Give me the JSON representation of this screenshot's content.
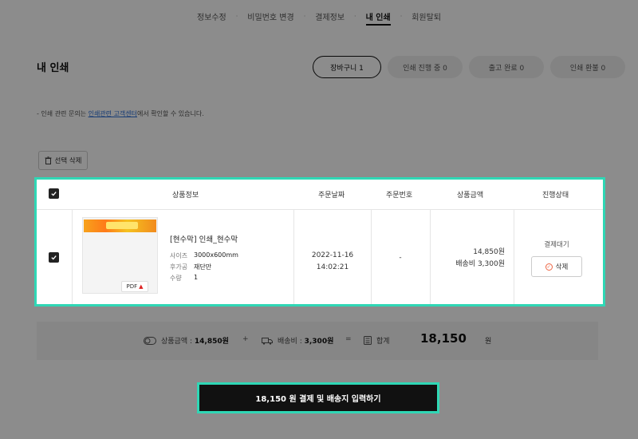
{
  "nav": [
    {
      "label": "정보수정",
      "active": false
    },
    {
      "label": "비밀번호 변경",
      "active": false
    },
    {
      "label": "결제정보",
      "active": false
    },
    {
      "label": "내 인쇄",
      "active": true
    },
    {
      "label": "회원탈퇴",
      "active": false
    }
  ],
  "nav_sep": "·",
  "page_title": "내 인쇄",
  "status_tabs": [
    "장바구니 1",
    "인쇄 진행 중 0",
    "출고 완료 0",
    "인쇄 환불 0"
  ],
  "notice": {
    "prefix": "- 인쇄 관련 문의는 ",
    "link": "인쇄관련 고객센터",
    "suffix": "에서 확인할 수 있습니다."
  },
  "delete_selected_label": "선택 삭제",
  "table": {
    "headers": [
      "상품정보",
      "주문날짜",
      "주문번호",
      "상품금액",
      "진행상태"
    ],
    "row": {
      "product_name": "[현수막] 인쇄_현수막",
      "specs": [
        {
          "label": "사이즈",
          "value": "3000x600mm"
        },
        {
          "label": "후가공",
          "value": "재단만"
        },
        {
          "label": "수량",
          "value": "1"
        }
      ],
      "pdf_label": "PDF",
      "date": "2022-11-16",
      "time": "14:02:21",
      "order_no": "-",
      "price": "14,850원",
      "shipping": "배송비 3,300원",
      "status": "결제대기",
      "delete_label": "삭제"
    }
  },
  "summary": {
    "product_amount_label": "상품금액 : ",
    "product_amount": "14,850원",
    "plus": "+",
    "shipping_label": "배송비 : ",
    "shipping": "3,300원",
    "equals": "=",
    "total_label": "합계",
    "total": "18,150",
    "won": "원"
  },
  "cta_label": "18,150 원 결제 및 배송지 입력하기",
  "colors": {
    "highlight": "#2fd7b5",
    "link": "#2b6ed6"
  }
}
